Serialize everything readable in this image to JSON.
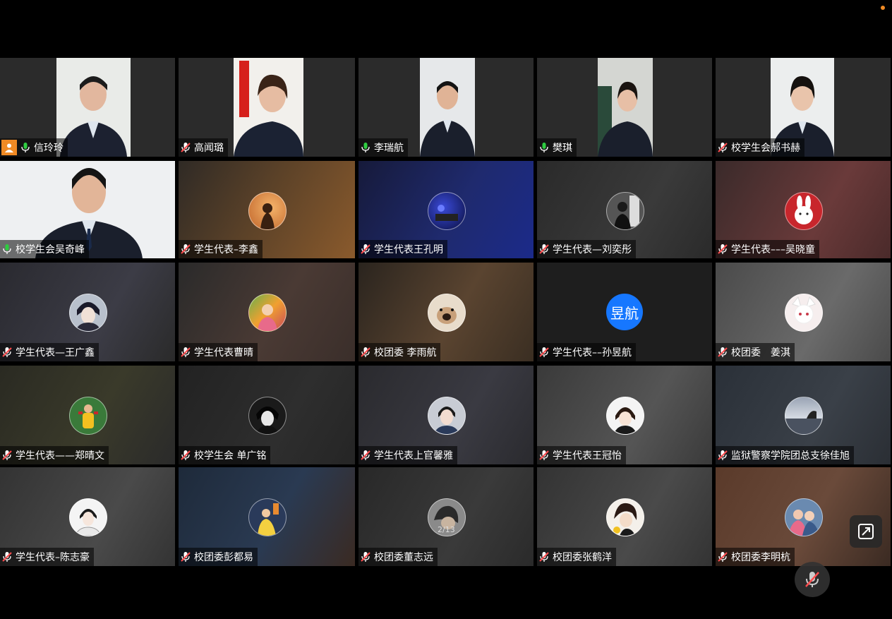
{
  "meeting": {
    "page_indicator": "2/13",
    "participants": [
      {
        "name": "信玲玲",
        "mic": "on",
        "kind": "video"
      },
      {
        "name": "高闻璐",
        "mic": "off",
        "kind": "video"
      },
      {
        "name": "李瑞航",
        "mic": "on",
        "kind": "video"
      },
      {
        "name": "樊琪",
        "mic": "on",
        "kind": "video"
      },
      {
        "name": "校学生会郝书赫",
        "mic": "off",
        "kind": "video"
      },
      {
        "name": "校学生会吴奇峰",
        "mic": "on",
        "kind": "video"
      },
      {
        "name": "学生代表–李鑫",
        "mic": "off",
        "kind": "avatar"
      },
      {
        "name": "学生代表王孔明",
        "mic": "off",
        "kind": "avatar"
      },
      {
        "name": "学生代表—刘奕彤",
        "mic": "off",
        "kind": "avatar"
      },
      {
        "name": "学生代表–––吴晓童",
        "mic": "off",
        "kind": "avatar"
      },
      {
        "name": "学生代表—王广鑫",
        "mic": "off",
        "kind": "avatar"
      },
      {
        "name": "学生代表曹晴",
        "mic": "off",
        "kind": "avatar"
      },
      {
        "name": "校团委 李雨航",
        "mic": "off",
        "kind": "avatar"
      },
      {
        "name": "学生代表––孙昱航",
        "mic": "off",
        "kind": "text-avatar",
        "avatar_text": "昱航"
      },
      {
        "name": "校团委　姜淇",
        "mic": "off",
        "kind": "avatar"
      },
      {
        "name": "学生代表——郑晴文",
        "mic": "off",
        "kind": "avatar"
      },
      {
        "name": "校学生会 单广铭",
        "mic": "off",
        "kind": "avatar"
      },
      {
        "name": "学生代表上官馨雅",
        "mic": "off",
        "kind": "avatar"
      },
      {
        "name": "学生代表王冠怡",
        "mic": "off",
        "kind": "avatar"
      },
      {
        "name": "监狱警察学院团总支徐佳旭",
        "mic": "off",
        "kind": "avatar"
      },
      {
        "name": "学生代表–陈志豪",
        "mic": "off",
        "kind": "avatar"
      },
      {
        "name": "校团委彭都易",
        "mic": "off",
        "kind": "avatar"
      },
      {
        "name": "校团委董志远",
        "mic": "off",
        "kind": "avatar"
      },
      {
        "name": "校团委张鹤洋",
        "mic": "off",
        "kind": "avatar"
      },
      {
        "name": "校团委李明杭",
        "mic": "off",
        "kind": "avatar"
      }
    ]
  },
  "colors": {
    "active_border": "#19c37d",
    "mic_on": "#2ecc40",
    "mic_off": "#ff4d4f",
    "text_avatar_bg": "#1677ff",
    "status_dot": "#f08a24"
  },
  "icons": {
    "mic_on": "mic-icon",
    "mic_off": "mic-muted-icon",
    "fullscreen": "fullscreen-icon",
    "self_mute": "mic-muted-icon",
    "self_user": "user-icon"
  }
}
